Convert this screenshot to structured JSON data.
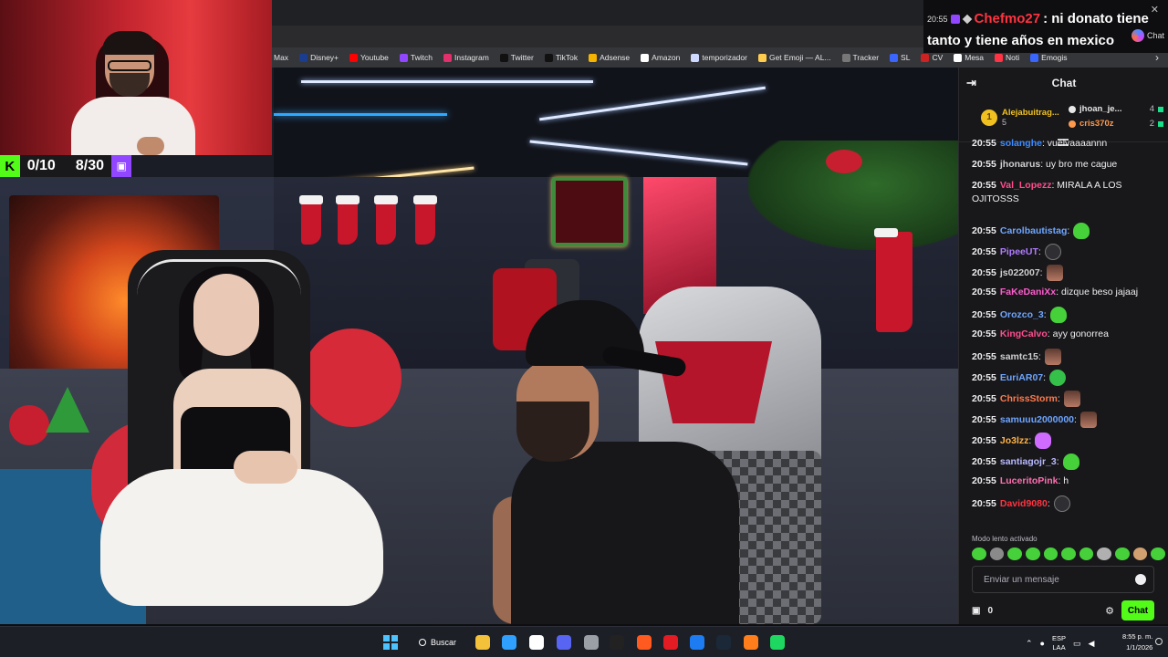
{
  "alert": {
    "time": "20:55",
    "user": "Chefmo27",
    "message_line1": ": ni donato tiene",
    "message_line2": "tanto y tiene años en mexico",
    "chat_label": "Chat",
    "close_glyph": "✕"
  },
  "bookmarks": [
    {
      "label": "Max",
      "color": "#3355ff"
    },
    {
      "label": "Disney+",
      "color": "#1a3d8f"
    },
    {
      "label": "Youtube",
      "color": "#ff0000"
    },
    {
      "label": "Twitch",
      "color": "#9146ff"
    },
    {
      "label": "Instagram",
      "color": "#e1306c"
    },
    {
      "label": "Twitter",
      "color": "#111111"
    },
    {
      "label": "TikTok",
      "color": "#111111"
    },
    {
      "label": "Adsense",
      "color": "#f4b400"
    },
    {
      "label": "Amazon",
      "color": "#ffffff"
    },
    {
      "label": "temporizador",
      "color": "#cfd8ff"
    },
    {
      "label": "Get Emoji — AL...",
      "color": "#ffcc4d"
    },
    {
      "label": "Tracker",
      "color": "#777777"
    },
    {
      "label": "SL",
      "color": "#3a66ff"
    },
    {
      "label": "CV",
      "color": "#cc2222"
    },
    {
      "label": "Mesa",
      "color": "#ffffff"
    },
    {
      "label": "Noti",
      "color": "#ff3344"
    },
    {
      "label": "Emogis",
      "color": "#3a66ff"
    }
  ],
  "counter": {
    "k_icon": "K",
    "value1": "0/10",
    "value2": "8/30",
    "twitch_glyph": "▣"
  },
  "chat": {
    "title": "Chat",
    "collapse_glyph": "⇥",
    "leaderboard": {
      "first": {
        "rank": "1",
        "name": "Alejabuitrag...",
        "points": "5"
      },
      "second": {
        "name": "jhoan_je...",
        "points": "4"
      },
      "third": {
        "name": "cris370z",
        "points": "2"
      }
    },
    "messages": [
      {
        "time": "20:55",
        "user": "solanghe",
        "color": "#3d8bff",
        "text": ": vuelvaaaannn",
        "emote": ""
      },
      {
        "time": "20:55",
        "user": "jhonarus",
        "color": "#cfcfcf",
        "text": ": uy bro me cague",
        "emote": ""
      },
      {
        "time": "20:55",
        "user": "Val_Lopezz",
        "color": "#ff4d8d",
        "text": ": MIRALA A LOS OJITOSSS",
        "emote": ""
      },
      {
        "time": "20:55",
        "user": "Carolbautistag",
        "color": "#6ea5ff",
        "text": ":",
        "emote": "green"
      },
      {
        "time": "20:55",
        "user": "PipeeUT",
        "color": "#b07cff",
        "text": ":",
        "emote": "speaker"
      },
      {
        "time": "20:55",
        "user": "js022007",
        "color": "#cfcfcf",
        "text": ":",
        "emote": "face"
      },
      {
        "time": "20:55",
        "user": "FaKeDaniXx",
        "color": "#ff5ccd",
        "text": ": dizque beso jajaaj",
        "emote": ""
      },
      {
        "time": "20:55",
        "user": "Orozco_3",
        "color": "#6ea5ff",
        "text": ":",
        "emote": "green"
      },
      {
        "time": "20:55",
        "user": "KingCalvo",
        "color": "#ff4d8d",
        "text": ": ayy gonorrea",
        "emote": ""
      },
      {
        "time": "20:55",
        "user": "samtc15",
        "color": "#cfcfcf",
        "text": ":",
        "emote": "face"
      },
      {
        "time": "20:55",
        "user": "EuriAR07",
        "color": "#6ea5ff",
        "text": ":",
        "emote": "cross"
      },
      {
        "time": "20:55",
        "user": "ChrissStorm",
        "color": "#ff7a4d",
        "text": ":",
        "emote": "face"
      },
      {
        "time": "20:55",
        "user": "samuuu2000000",
        "color": "#6ea5ff",
        "text": ":",
        "emote": "face"
      },
      {
        "time": "20:55",
        "user": "Jo3lzz",
        "color": "#ffb347",
        "text": ":",
        "emote": "pink"
      },
      {
        "time": "20:55",
        "user": "santiagojr_3",
        "color": "#b9b9ff",
        "text": ":",
        "emote": "green"
      },
      {
        "time": "20:55",
        "user": "LuceritoPink",
        "color": "#ff6fb0",
        "text": ": h",
        "emote": ""
      },
      {
        "time": "20:55",
        "user": "David9080",
        "color": "#ff3340",
        "text": ":",
        "emote": "speaker"
      }
    ],
    "slow_mode": "Modo lento activado",
    "input_placeholder": "Enviar un mensaje",
    "points": "0",
    "send_label": "Chat"
  },
  "taskbar": {
    "search_label": "Buscar",
    "lang_line1": "ESP",
    "lang_line2": "LAA",
    "time": "8:55 p. m.",
    "date": "1/1/2026",
    "apps": [
      "#f3c13a",
      "#2fa0ff",
      "#ffffff",
      "#5865f2",
      "#9aa0a6",
      "#222222",
      "#ff5a1f",
      "#e31b23",
      "#1d7cf2",
      "#1b2838",
      "#ff7d1a",
      "#1ed760"
    ]
  },
  "colors": {
    "accent_green": "#53fc18",
    "twitch_purple": "#9146ff",
    "chat_bg": "#18181b"
  }
}
